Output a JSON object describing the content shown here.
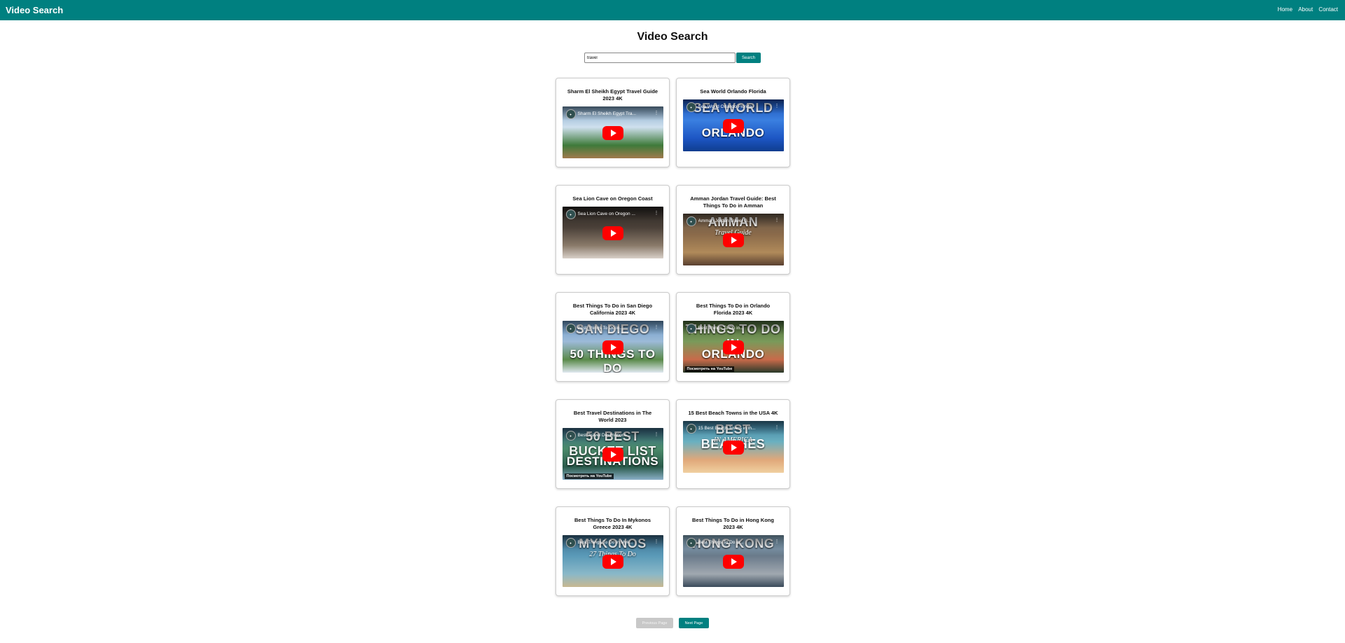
{
  "header": {
    "brand": "Video Search",
    "nav": [
      "Home",
      "About",
      "Contact"
    ]
  },
  "main": {
    "title": "Video Search",
    "search": {
      "value": "travel",
      "button_label": "Search"
    },
    "videos": [
      {
        "title": "Sharm El Sheikh Egypt Travel Guide 2023 4K",
        "embed_title": "Sharm El Sheikh Egypt Tra...",
        "overlay_text": "",
        "overlay_sub": "",
        "watch_label": "",
        "colors": [
          "#7fa6c9",
          "#cfe0ee",
          "#3e7a3a",
          "#a07a4c"
        ]
      },
      {
        "title": "Sea World Orlando Florida",
        "embed_title": "Sea World Orlando Florida",
        "overlay_text": "ORLANDO",
        "overlay_top": "SEA WORLD",
        "overlay_sub": "",
        "watch_label": "",
        "colors": [
          "#1a4fb3",
          "#3a7fe0",
          "#1d56c4",
          "#0f3d8f"
        ]
      },
      {
        "title": "Sea Lion Cave on Oregon Coast",
        "embed_title": "Sea Lion Cave on Oregon ...",
        "overlay_text": "",
        "overlay_sub": "",
        "watch_label": "",
        "colors": [
          "#2a2623",
          "#4a4038",
          "#8a7a6a",
          "#d8d0c8"
        ]
      },
      {
        "title": "Amman Jordan Travel Guide: Best Things To Do in Amman",
        "embed_title": "Amman Jordan Travel G...",
        "overlay_text": "",
        "overlay_top": "AMMAN",
        "overlay_sub": "Travel Guide",
        "watch_label": "",
        "colors": [
          "#6a5a4a",
          "#8a6a4a",
          "#b08a5a",
          "#5a4030"
        ]
      },
      {
        "title": "Best Things To Do in San Diego California 2023 4K",
        "embed_title": "Best Things To Do in...",
        "overlay_text": "50 THINGS TO DO",
        "overlay_top": "SAN DIEGO",
        "overlay_sub": "",
        "watch_label": "",
        "colors": [
          "#6a9ac8",
          "#9cbad8",
          "#5a8a4a",
          "#e0e8f0"
        ]
      },
      {
        "title": "Best Things To Do in Orlando Florida 2023 4K",
        "embed_title": "Best Things To Do in...",
        "overlay_text": "ORLANDO",
        "overlay_top": "THINGS TO DO IN",
        "overlay_sub": "",
        "watch_label": "Посмотреть на YouTube",
        "colors": [
          "#4a6a3a",
          "#7a9a5a",
          "#c86a4a",
          "#2a3a2a"
        ]
      },
      {
        "title": "Best Travel Destinations in The World 2023",
        "embed_title": "Best Travel Destinations...",
        "overlay_text": "DESTINATIONS",
        "overlay_top": "50 BEST BUCKET LIST",
        "overlay_sub": "",
        "watch_label": "Посмотреть на YouTube",
        "colors": [
          "#3a6a8a",
          "#4a8a6a",
          "#2a5a4a",
          "#8ab0c8"
        ]
      },
      {
        "title": "15 Best Beach Towns in the USA 4K",
        "embed_title": "15 Best Beach Towns in th...",
        "overlay_text": "",
        "overlay_top": "BEST BEACHES",
        "overlay_sub": "IN AMERICA",
        "watch_label": "",
        "colors": [
          "#3a7a9a",
          "#6ab0c0",
          "#e0a87a",
          "#f0d0a0"
        ]
      },
      {
        "title": "Best Things To Do In Mykonos Greece 2023 4K",
        "embed_title": "Best Things To Do In Myk...",
        "overlay_text": "",
        "overlay_top": "MYKONOS",
        "overlay_sub": "27 Things To Do",
        "watch_label": "",
        "colors": [
          "#3a6a8a",
          "#5a9ab8",
          "#8ab8c8",
          "#c8b890"
        ]
      },
      {
        "title": "Best Things To Do in Hong Kong 2023 4K",
        "embed_title": "Best Things To Do in...",
        "overlay_text": "",
        "overlay_top": "HONG KONG",
        "overlay_sub": "",
        "watch_label": "",
        "colors": [
          "#8ab0c8",
          "#6a7a8a",
          "#a0a8b0",
          "#3a4a5a"
        ]
      }
    ]
  },
  "pagination": {
    "prev_label": "Previous Page",
    "next_label": "Next Page"
  },
  "theme": {
    "accent": "#008080",
    "play": "#ff0000",
    "disabled": "#c8c8c8"
  }
}
